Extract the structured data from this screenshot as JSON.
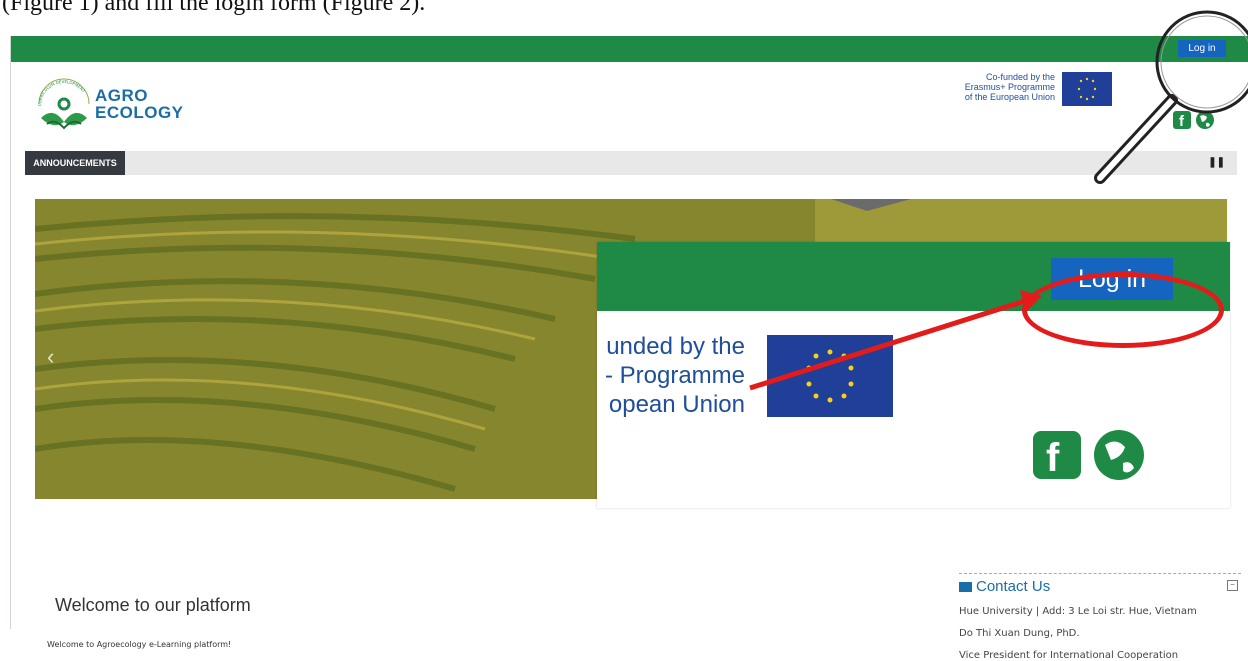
{
  "caption": "(Figure 1) and fill the login form (Figure 2).",
  "header": {
    "login_label": "Log in",
    "logo": {
      "arc_text": "CURRICULUM DEVELOPMENT",
      "line1": "AGRO",
      "line2": "ECOLOGY"
    },
    "eu_lines": [
      "Co-funded by the",
      "Erasmus+ Programme",
      "of the European Union"
    ],
    "social_icons": [
      "facebook-icon",
      "globe-icon"
    ]
  },
  "nav": {
    "announcements_label": "ANNOUNCEMENTS",
    "pause_label": "❚❚"
  },
  "hero": {
    "prev_label": "‹"
  },
  "zoom": {
    "login_label": "Log in",
    "eu_lines": [
      "unded by the",
      "- Programme",
      "opean Union"
    ]
  },
  "contact": {
    "title": "Contact Us",
    "line1": "Hue University  |  Add: 3 Le Loi str. Hue, Vietnam",
    "line2": "Do Thi Xuan Dung, PhD.",
    "line3": "Vice President for International Cooperation"
  },
  "welcome": {
    "title": "Welcome to our platform",
    "text": "Welcome to Agroecology e-Learning platform!"
  },
  "colors": {
    "brand_green": "#1e8a45",
    "login_blue": "#1565c0",
    "annotation_red": "#e31b1b",
    "eu_blue": "#1f3f99"
  }
}
